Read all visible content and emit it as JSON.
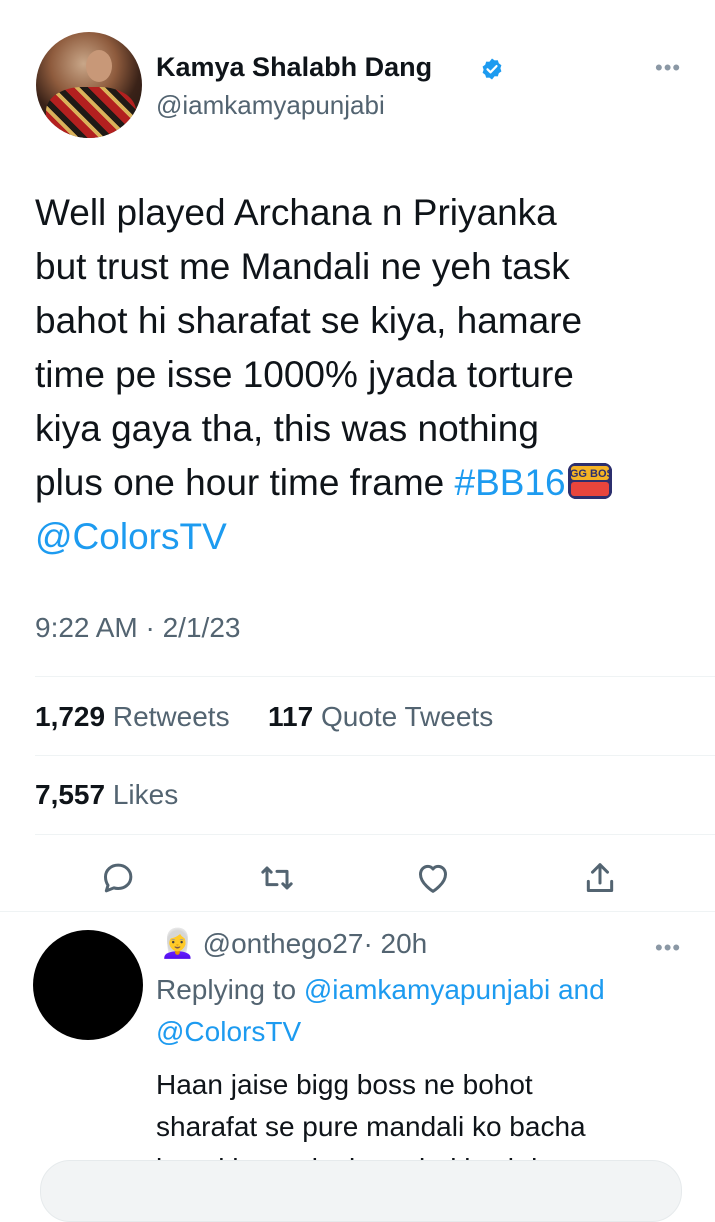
{
  "tweet": {
    "author_name": "Kamya Shalabh Dang",
    "author_handle": "@iamkamyapunjabi",
    "text_before": "Well played Archana n Priyanka\nbut trust me Mandali ne yeh task\nbahot hi sharafat se kiya, hamare\ntime pe isse 1000% jyada torture\nkiya gaya tha, this was nothing\nplus one hour time frame ",
    "hashtag": "#BB16",
    "mention": "@ColorsTV",
    "emoji_text": "BIGG BOSS",
    "time": "9:22 AM · 2/1/23"
  },
  "stats": {
    "retweets_count": "1,729",
    "retweets_label": "Retweets",
    "quotes_count": "117",
    "quotes_label": "Quote Tweets",
    "likes_count": "7,557",
    "likes_label": "Likes"
  },
  "actions": [
    "reply-icon",
    "retweet-icon",
    "like-icon",
    "share-icon"
  ],
  "reply": {
    "emoji": "👩‍🦳",
    "handle": "@onthego27",
    "time": "· 20h",
    "replying_prefix": "Replying to ",
    "replying_to_1": "@iamkamyapunjabi",
    "replying_and": " and",
    "replying_to_2": "@ColorsTV",
    "text": "Haan jaise bigg boss ne bohot\nsharafat se pure mandali ko bacha\nke rakha end tak aur baki sab ko"
  },
  "colors": {
    "link": "#1d9bf0",
    "secondary": "#536471",
    "text": "#0f1419",
    "divider": "#eff3f4"
  }
}
